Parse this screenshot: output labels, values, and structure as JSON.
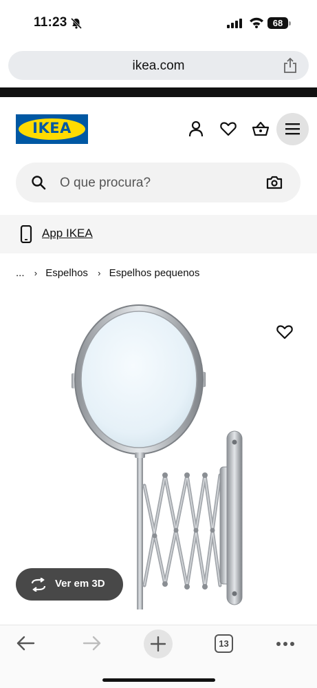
{
  "status_bar": {
    "time": "11:23",
    "battery": "68",
    "icons": [
      "bell-slash-icon",
      "cellular-signal-icon",
      "wifi-icon",
      "battery-icon"
    ]
  },
  "browser": {
    "url": "ikea.com",
    "share_icon": "share-icon",
    "toolbar": {
      "back_icon": "arrow-left-icon",
      "forward_icon": "arrow-right-icon",
      "new_tab_icon": "plus-icon",
      "tabs_count": "13",
      "more_icon": "ellipsis-icon"
    }
  },
  "header": {
    "logo_text": "IKEA",
    "icons": [
      "user-icon",
      "heart-icon",
      "basket-icon",
      "menu-icon"
    ]
  },
  "search": {
    "placeholder": "O que procura?",
    "camera_icon": "camera-icon"
  },
  "app_banner": {
    "label": "App IKEA",
    "icon": "phone-icon"
  },
  "breadcrumb": {
    "items": [
      "...",
      "Espelhos",
      "Espelhos pequenos"
    ]
  },
  "product": {
    "image": "extendable wall mirror",
    "view_3d_label": "Ver em 3D",
    "favourite_icon": "heart-icon"
  },
  "colors": {
    "ikea_blue": "#0058a3",
    "ikea_yellow": "#ffdb00",
    "button_dark": "#484848"
  }
}
